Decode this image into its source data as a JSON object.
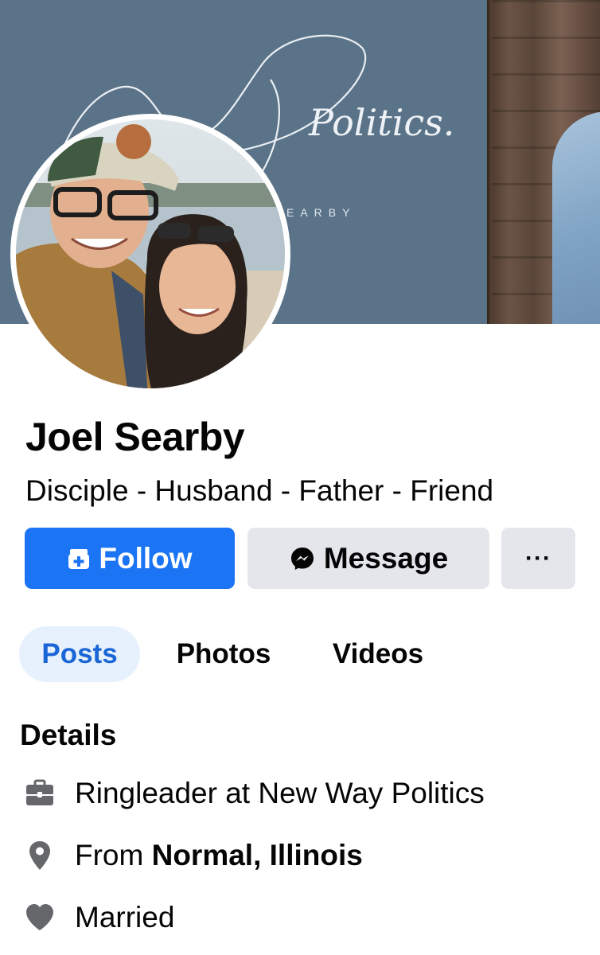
{
  "cover": {
    "brand_text": "Politics.",
    "subtitle_text": "EARBY",
    "colors": {
      "background": "#5b7388",
      "wood": "#5a4638"
    }
  },
  "avatar": {
    "icon": "profile-photo"
  },
  "profile": {
    "name": "Joel Searby",
    "bio": "Disciple - Husband - Father - Friend"
  },
  "actions": {
    "follow_label": "Follow",
    "follow_icon": "follow-icon",
    "message_label": "Message",
    "message_icon": "messenger-icon",
    "more_label": "···"
  },
  "tabs": [
    {
      "label": "Posts",
      "active": true
    },
    {
      "label": "Photos",
      "active": false
    },
    {
      "label": "Videos",
      "active": false
    }
  ],
  "details": {
    "title": "Details",
    "items": [
      {
        "icon": "briefcase-icon",
        "text": "Ringleader at New Way Politics"
      },
      {
        "icon": "location-pin-icon",
        "prefix": "From ",
        "bold": "Normal, Illinois"
      },
      {
        "icon": "heart-icon",
        "text": "Married"
      }
    ]
  },
  "colors": {
    "accent": "#1b74f4",
    "tab_active_bg": "#e7f0fd",
    "tab_active_text": "#1b66d6",
    "button_secondary": "#e4e6eb",
    "icon_gray": "#65676b"
  }
}
